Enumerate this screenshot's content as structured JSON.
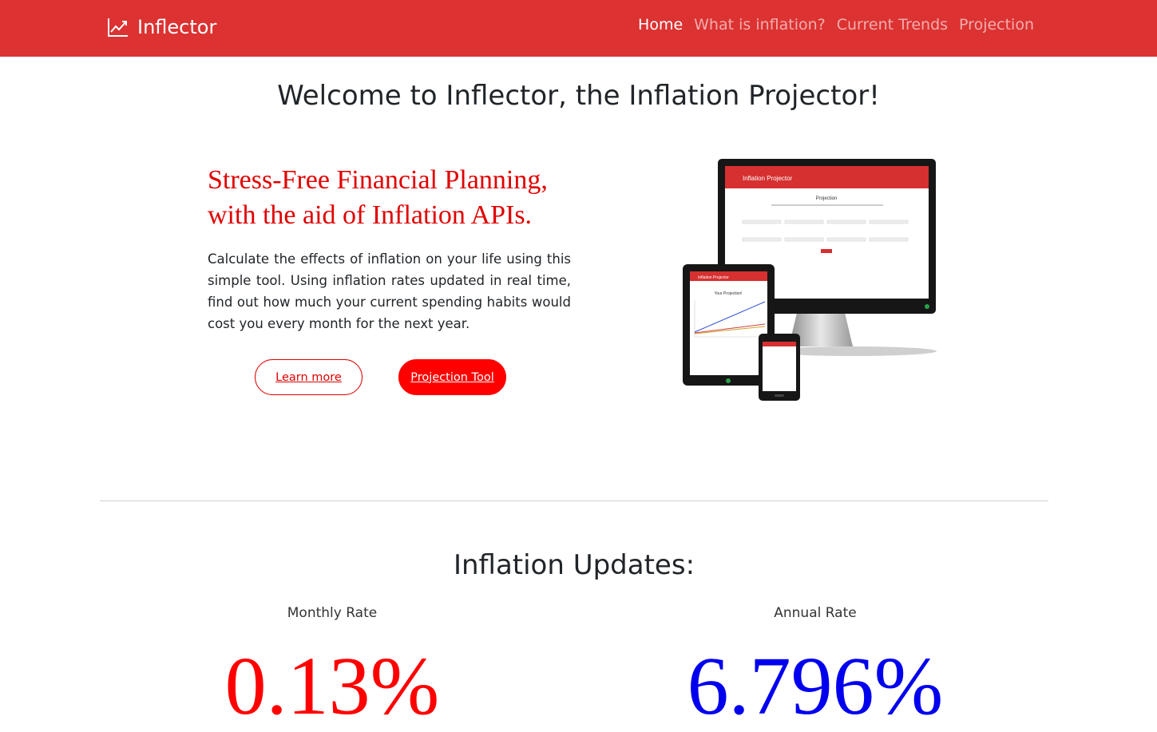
{
  "navbar": {
    "brand": "Inflector",
    "brand_icon": "trending-up-icon",
    "background": "#dc3232",
    "links": [
      {
        "label": "Home",
        "active": true
      },
      {
        "label": "What is inflation?",
        "active": false
      },
      {
        "label": "Current Trends",
        "active": false
      },
      {
        "label": "Projection",
        "active": false
      }
    ]
  },
  "welcome": "Welcome to Inflector, the Inflation Projector!",
  "hero": {
    "title_line1": "Stress-Free Financial Planning,",
    "title_line2": "with the aid of Inflation APIs.",
    "text": "Calculate the effects of inflation on your life using this simple tool. Using inflation rates updated in real time, find out how much your current spending habits would cost you every month for the next year.",
    "learn_more": "Learn more",
    "projection_tool": "Projection Tool"
  },
  "devices_image": {
    "monitor_app_title": "Inflation Projector",
    "monitor_heading": "Projection",
    "tablet_app_title": "Inflation Projector",
    "tablet_heading": "Your Projection!"
  },
  "updates": {
    "title": "Inflation Updates:",
    "monthly_label": "Monthly Rate",
    "monthly_value": "0.13%",
    "monthly_color": "#ff0000",
    "annual_label": "Annual Rate",
    "annual_value": "6.796%",
    "annual_color": "#0000ee"
  }
}
